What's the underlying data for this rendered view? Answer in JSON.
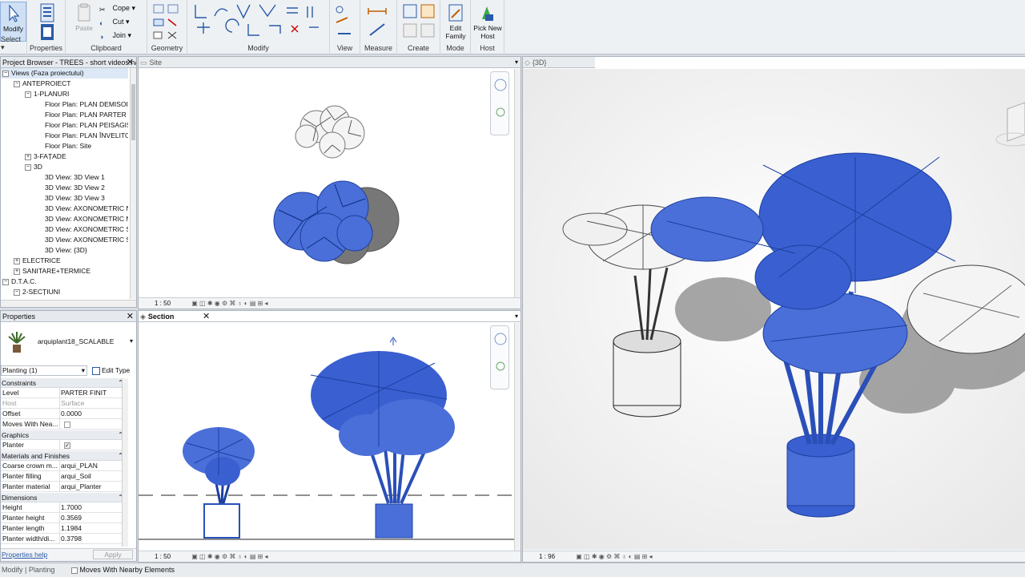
{
  "ribbon": {
    "modify_label": "Modify",
    "select_label": "Select",
    "properties_label": "Properties",
    "clipboard": {
      "paste": "Paste",
      "cope": "Cope",
      "cut": "Cut",
      "join": "Join",
      "label": "Clipboard"
    },
    "geometry_label": "Geometry",
    "modify_group_label": "Modify",
    "view_label": "View",
    "measure_label": "Measure",
    "create_label": "Create",
    "edit_family": "Edit Family",
    "mode_label": "Mode",
    "pick_new_host": "Pick New Host",
    "host_label": "Host"
  },
  "project_browser": {
    "title": "Project Browser - TREES - short videos.rvt",
    "items": [
      {
        "indent": 0,
        "toggle": "−",
        "label": "Views (Faza proiectului)",
        "selected": true
      },
      {
        "indent": 1,
        "toggle": "−",
        "label": "ANTEPROIECT"
      },
      {
        "indent": 2,
        "toggle": "−",
        "label": "1-PLANURI"
      },
      {
        "indent": 3,
        "toggle": "",
        "label": "Floor Plan: PLAN DEMISOI"
      },
      {
        "indent": 3,
        "toggle": "",
        "label": "Floor Plan: PLAN PARTER"
      },
      {
        "indent": 3,
        "toggle": "",
        "label": "Floor Plan: PLAN PEISAGIST"
      },
      {
        "indent": 3,
        "toggle": "",
        "label": "Floor Plan: PLAN ÎNVELITO"
      },
      {
        "indent": 3,
        "toggle": "",
        "label": "Floor Plan: Site"
      },
      {
        "indent": 2,
        "toggle": "+",
        "label": "3-FAȚADE"
      },
      {
        "indent": 2,
        "toggle": "−",
        "label": "3D"
      },
      {
        "indent": 3,
        "toggle": "",
        "label": "3D View: 3D View 1"
      },
      {
        "indent": 3,
        "toggle": "",
        "label": "3D View: 3D View 2"
      },
      {
        "indent": 3,
        "toggle": "",
        "label": "3D View: 3D View 3"
      },
      {
        "indent": 3,
        "toggle": "",
        "label": "3D View: AXONOMETRIC N"
      },
      {
        "indent": 3,
        "toggle": "",
        "label": "3D View: AXONOMETRIC N"
      },
      {
        "indent": 3,
        "toggle": "",
        "label": "3D View: AXONOMETRIC S"
      },
      {
        "indent": 3,
        "toggle": "",
        "label": "3D View: AXONOMETRIC S"
      },
      {
        "indent": 3,
        "toggle": "",
        "label": "3D View: {3D}"
      },
      {
        "indent": 1,
        "toggle": "+",
        "label": "ELECTRICE"
      },
      {
        "indent": 1,
        "toggle": "+",
        "label": "SANITARE+TERMICE"
      },
      {
        "indent": 0,
        "toggle": "−",
        "label": "D.T.A.C."
      },
      {
        "indent": 1,
        "toggle": "−",
        "label": "2-SECȚIUNI"
      }
    ]
  },
  "properties": {
    "title": "Properties",
    "family_name": "arquiplant18_SCALABLE",
    "filter_value": "Planting (1)",
    "edit_type": "Edit Type",
    "categories": {
      "constraints": "Constraints",
      "graphics": "Graphics",
      "materials": "Materials and Finishes",
      "dimensions": "Dimensions"
    },
    "rows": {
      "level": {
        "k": "Level",
        "v": "PARTER FINIT"
      },
      "host": {
        "k": "Host",
        "v": "Surface"
      },
      "offset": {
        "k": "Offset",
        "v": "0.0000"
      },
      "moves": {
        "k": "Moves With Nea...",
        "v": ""
      },
      "planter": {
        "k": "Planter",
        "v": ""
      },
      "crown": {
        "k": "Coarse crown m...",
        "v": "arqui_PLAN"
      },
      "filling": {
        "k": "Planter filling",
        "v": "arqui_Soil"
      },
      "material": {
        "k": "Planter material",
        "v": "arqui_Planter"
      },
      "height": {
        "k": "Height",
        "v": "1.7000"
      },
      "pheight": {
        "k": "Planter height",
        "v": "0.3569"
      },
      "plength": {
        "k": "Planter length",
        "v": "1.1984"
      },
      "pwidth": {
        "k": "Planter width/di...",
        "v": "0.3798"
      }
    },
    "help": "Properties help",
    "apply": "Apply"
  },
  "views": {
    "site": {
      "title": "Site",
      "scale": "1 : 50"
    },
    "section": {
      "title": "Section",
      "scale": "1 : 50"
    },
    "threed": {
      "title": "{3D}",
      "scale": "1 : 96"
    }
  },
  "status": {
    "left": "Modify | Planting",
    "checkbox_label": "Moves With Nearby Elements"
  },
  "colors": {
    "selection_blue": "#3a5fd0",
    "ribbon_bg": "#eef1f4"
  }
}
